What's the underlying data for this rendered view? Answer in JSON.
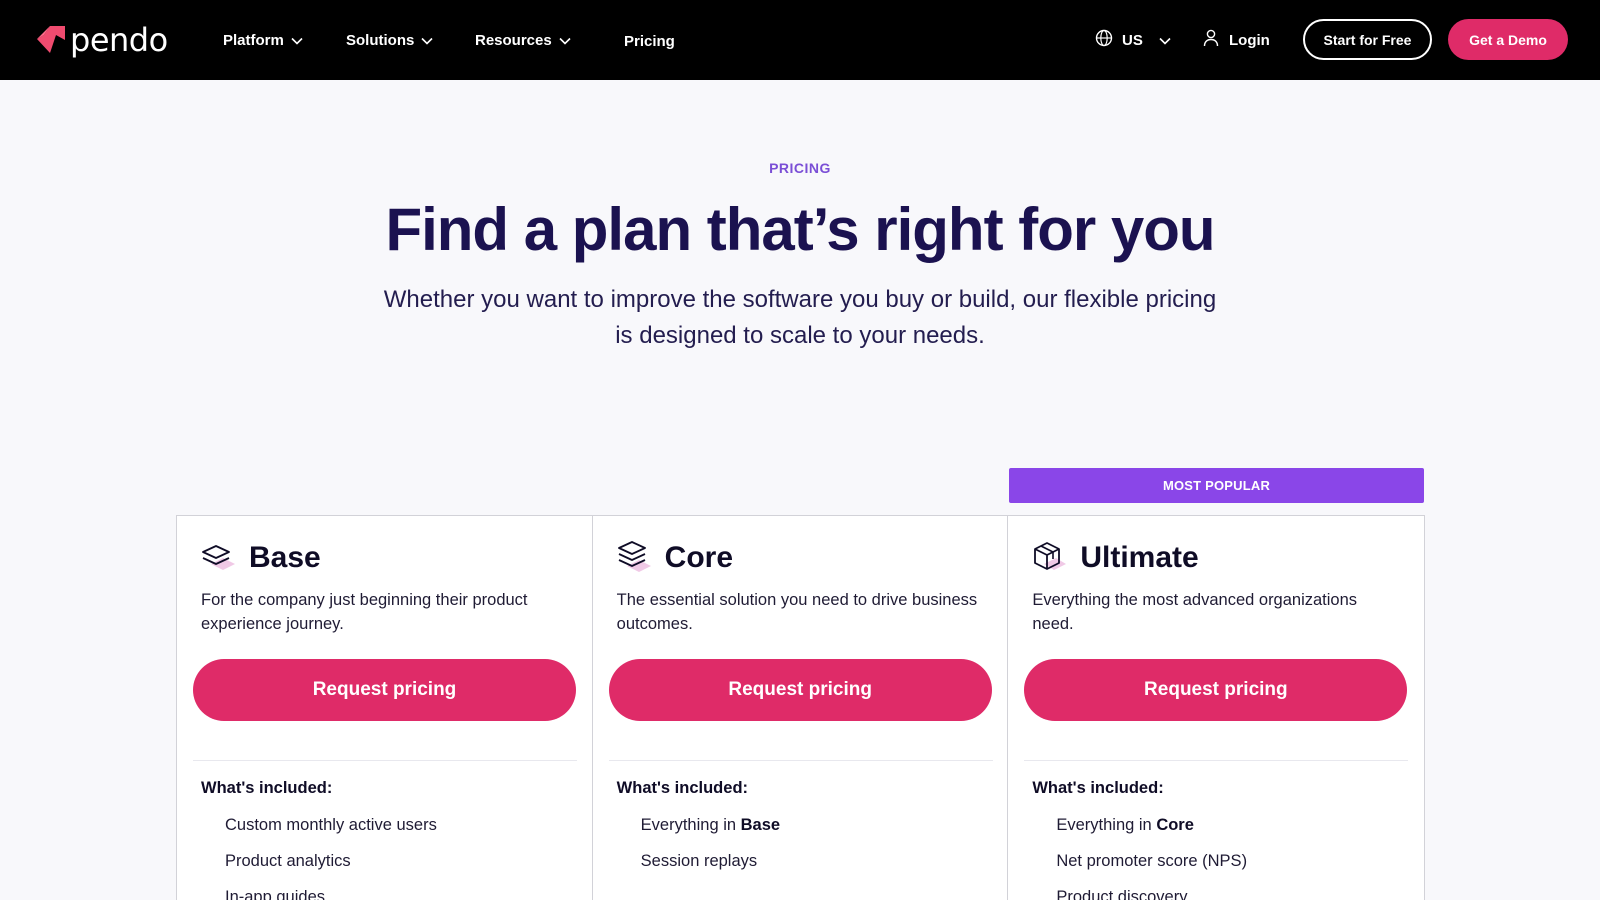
{
  "brand": {
    "name": "pendo",
    "accent": "#df2b68",
    "purple": "#8a46e8"
  },
  "nav": {
    "items": [
      {
        "label": "Platform",
        "has_dropdown": true
      },
      {
        "label": "Solutions",
        "has_dropdown": true
      },
      {
        "label": "Resources",
        "has_dropdown": true
      },
      {
        "label": "Pricing",
        "has_dropdown": false
      }
    ],
    "region": "US",
    "login": "Login",
    "start_free": "Start for Free",
    "get_demo": "Get a Demo"
  },
  "hero": {
    "eyebrow": "PRICING",
    "title": "Find a plan that’s right for you",
    "subtitle": "Whether you want to improve the software you buy or build, our flexible pricing is designed to scale to your needs."
  },
  "pricing": {
    "popular_badge": "MOST POPULAR",
    "included_label": "What's included:",
    "plans": [
      {
        "name": "Base",
        "icon": "layers-icon",
        "description": "For the company just beginning their product experience journey.",
        "cta": "Request pricing",
        "features": [
          {
            "text": "Custom monthly active users",
            "bold": ""
          },
          {
            "text": "Product analytics",
            "bold": ""
          },
          {
            "text": "In-app guides",
            "bold": ""
          }
        ]
      },
      {
        "name": "Core",
        "icon": "stacked-layers-icon",
        "description": "The essential solution you need to drive business outcomes.",
        "cta": "Request pricing",
        "features": [
          {
            "text": "Everything in ",
            "bold": "Base"
          },
          {
            "text": "Session replays",
            "bold": ""
          }
        ]
      },
      {
        "name": "Ultimate",
        "icon": "cube-icon",
        "description": "Everything the most advanced organizations need.",
        "cta": "Request pricing",
        "features": [
          {
            "text": "Everything in ",
            "bold": "Core"
          },
          {
            "text": "Net promoter score (NPS)",
            "bold": ""
          },
          {
            "text": "Product discovery",
            "bold": ""
          }
        ]
      }
    ]
  }
}
